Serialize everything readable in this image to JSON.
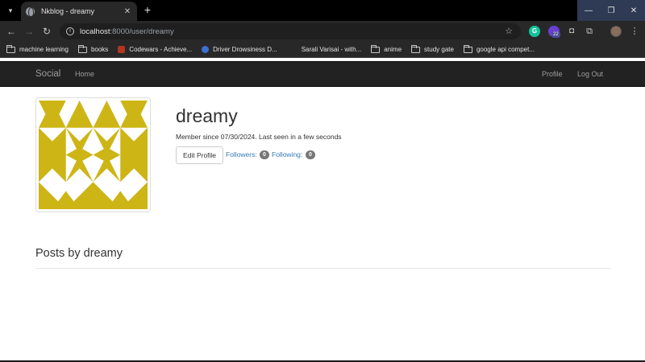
{
  "browser": {
    "tab_title": "Nkblog - dreamy",
    "url_host": "localhost",
    "url_path": ":8000/user/dreamy",
    "extension_badge": "22",
    "bookmarks": [
      {
        "label": "machine learning",
        "icon": "folder-icon"
      },
      {
        "label": "books",
        "icon": "folder-icon"
      },
      {
        "label": "Codewars - Achieve...",
        "icon": "codewars-icon"
      },
      {
        "label": "Driver Drowsiness D...",
        "icon": "site-icon"
      },
      {
        "label": "Sarali Varisai - with...",
        "icon": "none"
      },
      {
        "label": "anime",
        "icon": "folder-icon"
      },
      {
        "label": "study gate",
        "icon": "folder-icon"
      },
      {
        "label": "google api compet...",
        "icon": "folder-icon"
      }
    ]
  },
  "navbar": {
    "brand": "Social",
    "home": "Home",
    "profile": "Profile",
    "logout": "Log Out"
  },
  "profile": {
    "username": "dreamy",
    "member_info": "Member since 07/30/2024. Last seen in a few seconds",
    "edit_button": "Edit Profile",
    "followers_label": "Followers:",
    "followers_count": "0",
    "following_label": "Following:",
    "following_count": "0",
    "avatar_color": "#cdb515"
  },
  "posts": {
    "heading": "Posts by dreamy"
  }
}
